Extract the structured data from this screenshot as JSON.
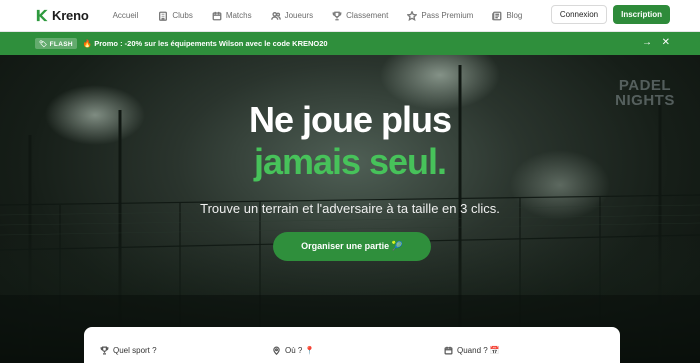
{
  "brand": {
    "name": "Kreno",
    "color": "#2e8b3a"
  },
  "nav": {
    "items": [
      {
        "label": "Accueil",
        "icon": "none"
      },
      {
        "label": "Clubs",
        "icon": "building-icon"
      },
      {
        "label": "Matchs",
        "icon": "calendar-icon"
      },
      {
        "label": "Joueurs",
        "icon": "users-icon"
      },
      {
        "label": "Classement",
        "icon": "trophy-icon"
      },
      {
        "label": "Pass Premium",
        "icon": "star-icon"
      },
      {
        "label": "Blog",
        "icon": "newspaper-icon"
      }
    ],
    "login_label": "Connexion",
    "signup_label": "Inscription"
  },
  "flash": {
    "badge": "🏷 FLASH",
    "text": "🔥 Promo : -20% sur les équipements Wilson avec le code KRENO20",
    "arrow": "→",
    "close": "✕"
  },
  "hero": {
    "title_line1": "Ne joue plus",
    "title_line2": "jamais seul.",
    "subtitle": "Trouve un terrain et l'adversaire à ta taille en 3 clics.",
    "cta_label": "Organiser une partie 🎾",
    "neon_sign": "PADEL NIGHTS",
    "accent_color": "#47c25a"
  },
  "search": {
    "sport_label": "Quel sport ?",
    "where_label": "Où ? 📍",
    "when_label": "Quand ? 📅"
  }
}
